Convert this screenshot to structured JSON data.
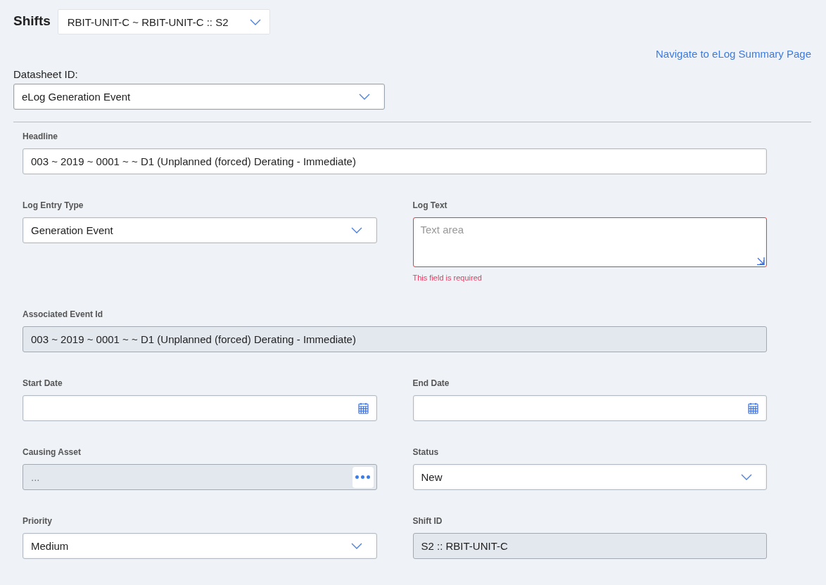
{
  "shifts": {
    "label": "Shifts",
    "value": "RBIT-UNIT-C ~ RBIT-UNIT-C :: S2"
  },
  "summary_link": "Navigate to eLog Summary Page",
  "datasheet": {
    "label": "Datasheet ID:",
    "value": "eLog Generation Event"
  },
  "rows": [
    [
      {
        "label": "Headline",
        "kind": "text",
        "value": "003 ~ 2019 ~ 0001 ~  ~ D1 (Unplanned (forced) Derating - Immediate)",
        "disabled": false
      }
    ],
    [
      {
        "label": "Log Entry Type",
        "kind": "select",
        "value": "Generation Event",
        "disabled": false
      },
      {
        "label": "Log Text",
        "kind": "textarea",
        "placeholder": "Text area",
        "error": "This field is required",
        "disabled": false
      }
    ],
    [
      {
        "label": "Associated Event Id",
        "kind": "text",
        "value": "003 ~ 2019 ~ 0001 ~  ~ D1 (Unplanned (forced) Derating - Immediate)",
        "disabled": true
      }
    ],
    [
      {
        "label": "Start Date",
        "kind": "date",
        "disabled": false
      },
      {
        "label": "End Date",
        "kind": "date",
        "disabled": false
      }
    ],
    [
      {
        "label": "Causing Asset",
        "kind": "lookup",
        "placeholder": "...",
        "disabled": true
      },
      {
        "label": "Status",
        "kind": "select",
        "value": "New",
        "disabled": false
      }
    ],
    [
      {
        "label": "Priority",
        "kind": "select",
        "value": "Medium",
        "disabled": false
      },
      {
        "label": "Shift ID",
        "kind": "text",
        "value": "S2 :: RBIT-UNIT-C",
        "disabled": true
      }
    ]
  ]
}
